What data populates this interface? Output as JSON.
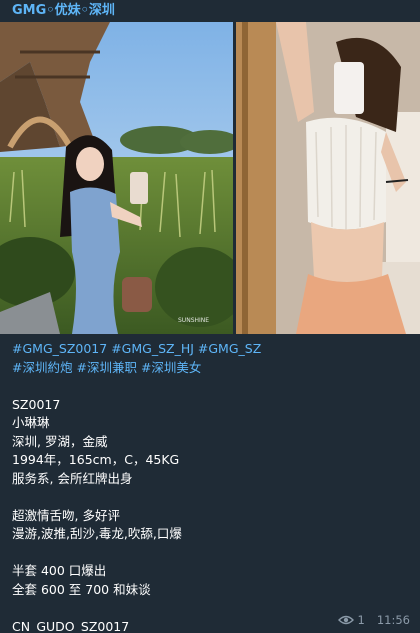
{
  "header": {
    "title": "GMG◦优妹◦深圳"
  },
  "photos": {
    "watermark": "SUNSHINE"
  },
  "message": {
    "hashtags_line1": [
      "#GMG_SZ0017",
      "#GMG_SZ_HJ",
      "#GMG_SZ"
    ],
    "hashtags_line2": [
      "#深圳約炮",
      "#深圳兼职",
      "#深圳美女"
    ],
    "lines": [
      "SZ0017",
      "小琳琳",
      "深圳, 罗湖，金威",
      "1994年，165cm，C，45KG",
      "服务系, 会所红牌出身",
      "",
      "超激情舌吻, 多好评",
      "漫游,波推,刮沙,毒龙,吹舔,口爆",
      "",
      "半套 400 口爆出",
      "全套 600 至 700 和妹谈",
      "",
      "CN_GUDO_SZ0017"
    ]
  },
  "meta": {
    "views": "1",
    "time": "11:56"
  },
  "colors": {
    "background": "#1f2b36",
    "link": "#5eb5f7",
    "text": "#ffffff",
    "meta": "#8b9aa8"
  }
}
